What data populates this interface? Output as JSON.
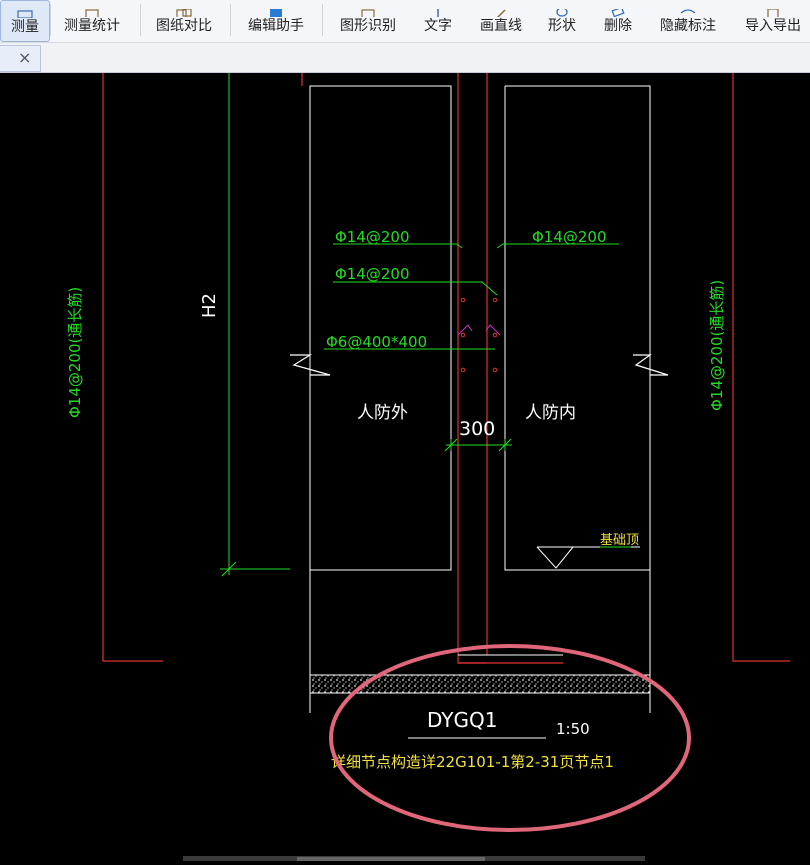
{
  "toolbar": {
    "items": [
      {
        "label": "测量",
        "icon": "ruler-icon",
        "active": true
      },
      {
        "label": "测量统计",
        "icon": "measure-stats-icon"
      },
      {
        "label": "图纸对比",
        "icon": "compare-drawings-icon"
      },
      {
        "label": "编辑助手",
        "icon": "edit-assistant-icon"
      },
      {
        "label": "图形识别",
        "icon": "shape-recognition-icon"
      },
      {
        "label": "文字",
        "icon": "text-icon"
      },
      {
        "label": "画直线",
        "icon": "line-icon"
      },
      {
        "label": "形状",
        "icon": "shape-icon"
      },
      {
        "label": "删除",
        "icon": "eraser-icon"
      },
      {
        "label": "隐藏标注",
        "icon": "hide-annotation-icon"
      },
      {
        "label": "导入导出",
        "icon": "import-export-icon"
      }
    ]
  },
  "tab": {
    "close_symbol": "×"
  },
  "drawing": {
    "rebar_left_vertical": "Φ14@200(通长筋)",
    "rebar_right_vertical": "Φ14@200(通长筋)",
    "height_label": "H2",
    "rebar_top_left": "Φ14@200",
    "rebar_top_right": "Φ14@200",
    "rebar_second": "Φ14@200",
    "tie_bar": "Φ6@400*400",
    "label_outside": "人防外",
    "label_inside": "人防内",
    "wall_thickness": "300",
    "foundation_top": "基础顶",
    "title": "DYGQ1",
    "scale": "1:50",
    "detail_ref": "详细节点构造详22G101-1第2-31页节点1"
  },
  "colors": {
    "background": "#000000",
    "red_line": "#e03030",
    "white_line": "#ffffff",
    "green": "#22dd22",
    "yellow": "#f0e040",
    "pink_circle": "#e0667a"
  }
}
